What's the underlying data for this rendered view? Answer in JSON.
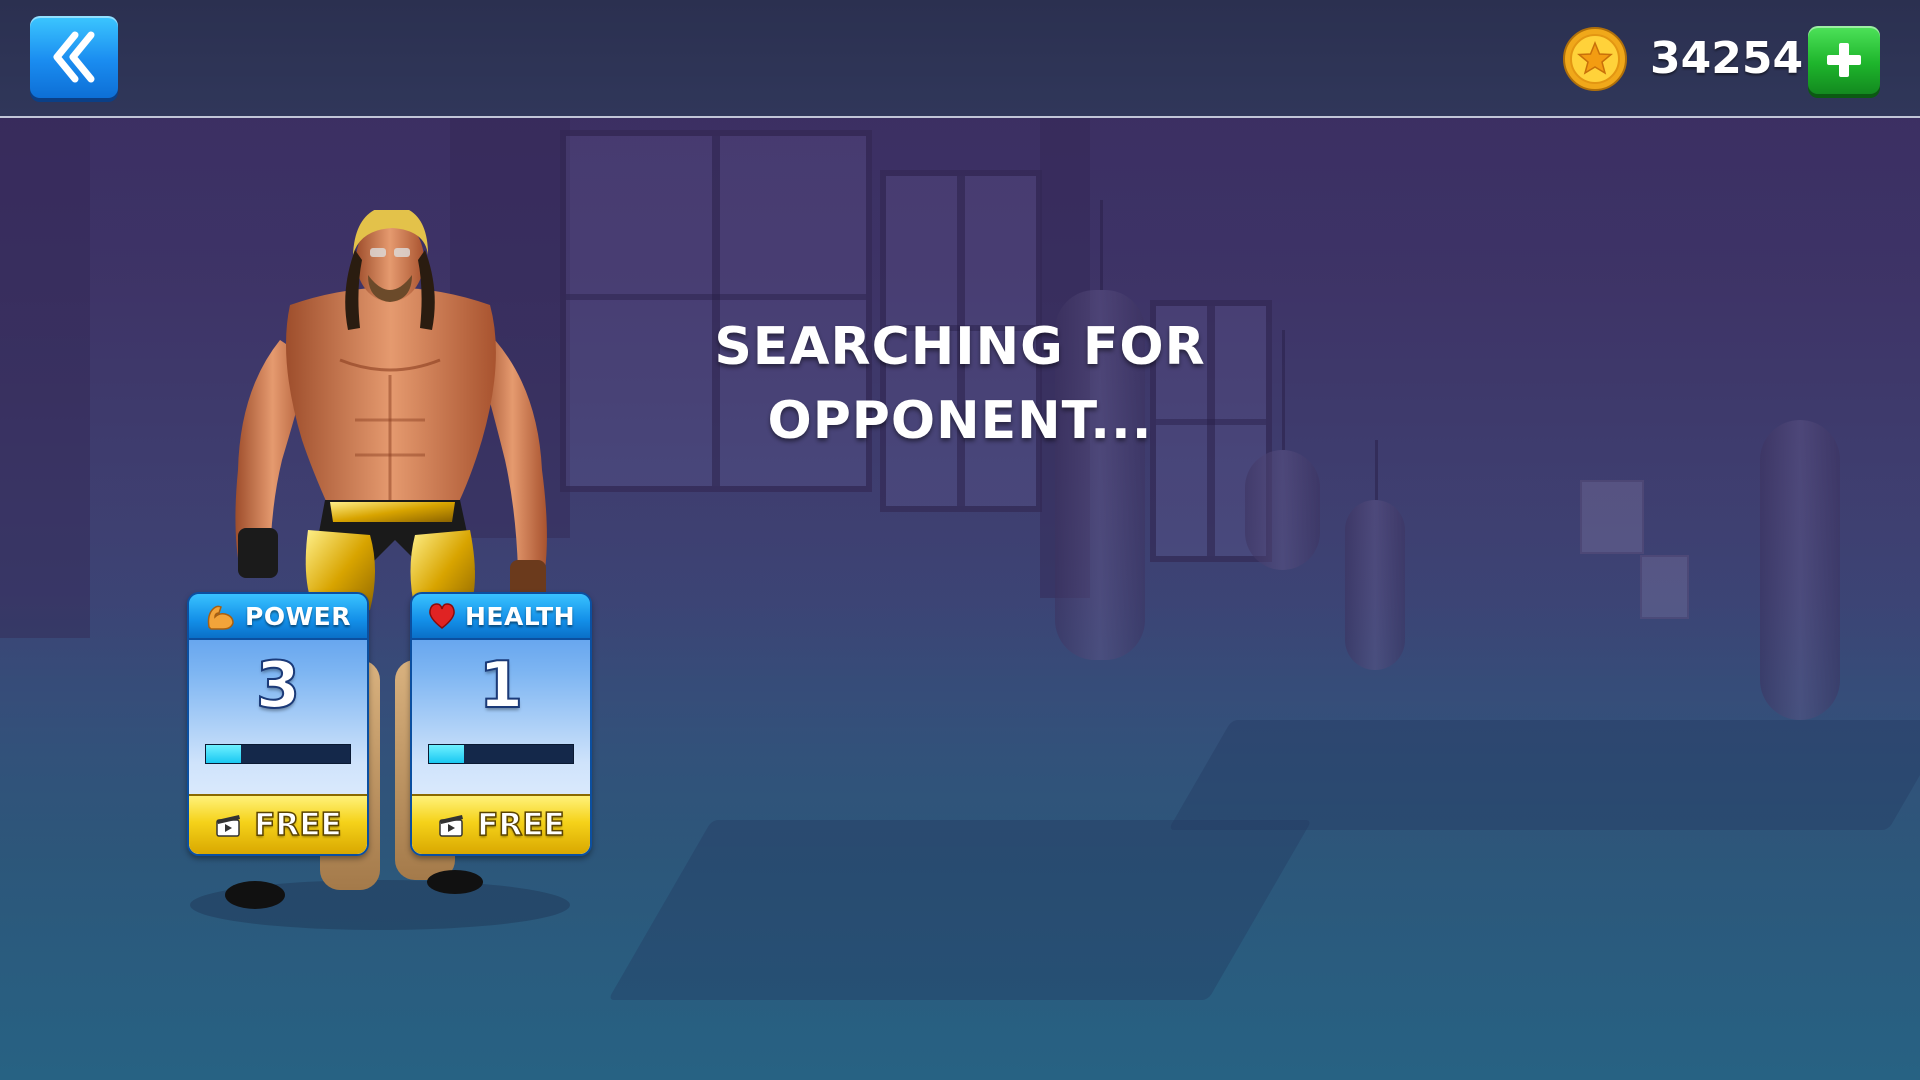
{
  "header": {
    "back_icon": "double-chevron-left-icon",
    "coin_icon": "gold-star-coin-icon",
    "coins": "34254",
    "add_icon": "plus-icon"
  },
  "status": {
    "line1": "SEARCHING FOR",
    "line2": "OPPONENT..."
  },
  "stats": [
    {
      "title": "POWER",
      "icon": "flexed-arm-icon",
      "value": "3",
      "progress": 0.24,
      "button_label": "FREE",
      "button_icon": "video-ad-icon"
    },
    {
      "title": "HEALTH",
      "icon": "heart-icon",
      "value": "1",
      "progress": 0.24,
      "button_label": "FREE",
      "button_icon": "video-ad-icon"
    }
  ],
  "colors": {
    "back_button": "#1a8cf0",
    "add_button": "#1eb52c",
    "free_button": "#f5d21a",
    "progress_fill": "#19c8f2"
  }
}
